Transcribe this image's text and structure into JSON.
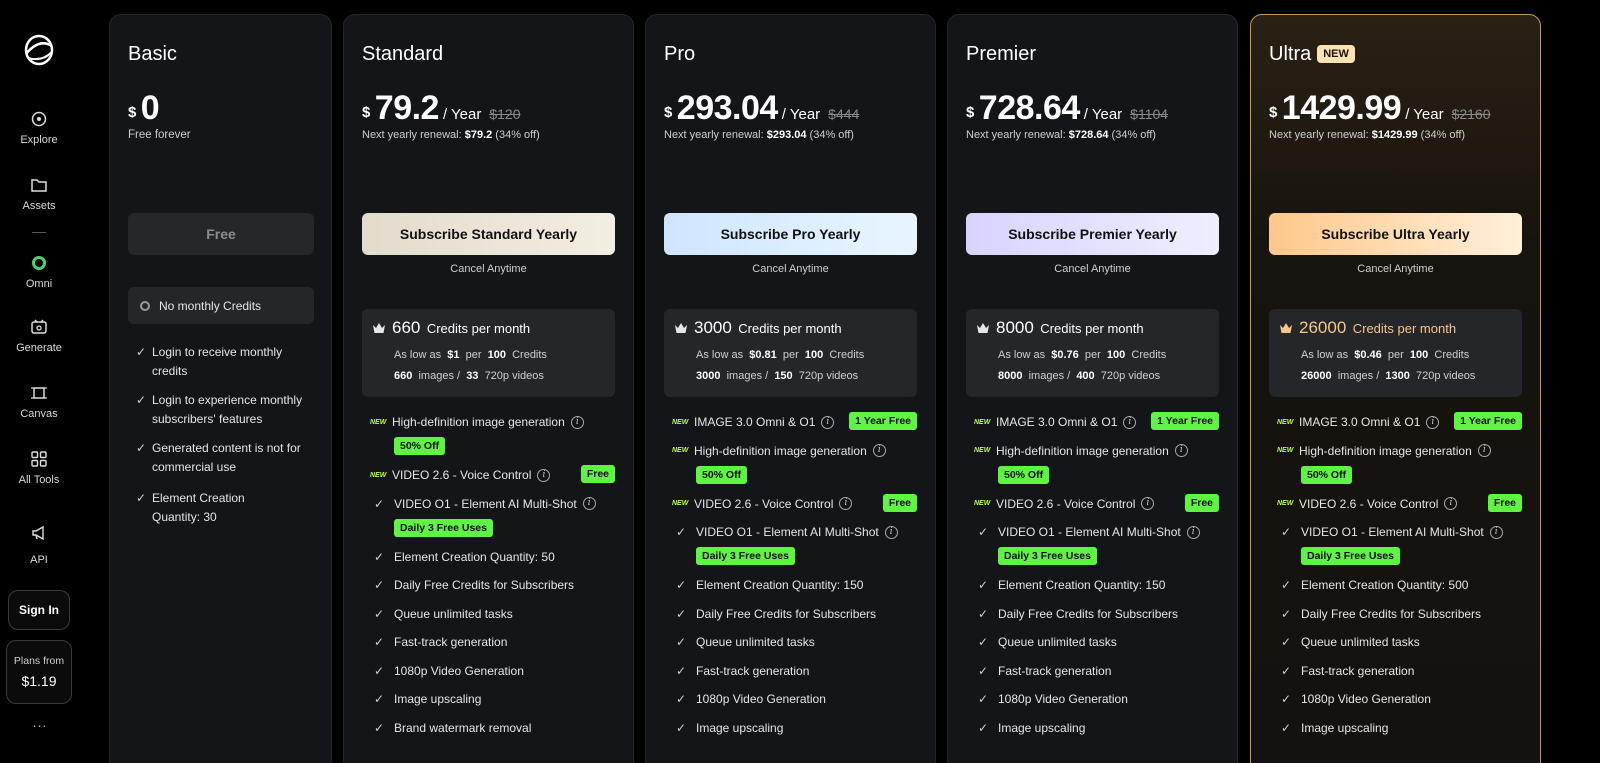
{
  "sidebar": {
    "items": [
      {
        "label": "Explore",
        "icon": "explore-icon"
      },
      {
        "label": "Assets",
        "icon": "folder-icon"
      },
      {
        "label": "Omni",
        "icon": "omni-icon"
      },
      {
        "label": "Generate",
        "icon": "generate-icon"
      },
      {
        "label": "Canvas",
        "icon": "canvas-icon"
      },
      {
        "label": "All Tools",
        "icon": "grid-icon"
      },
      {
        "label": "API",
        "icon": "megaphone-icon"
      }
    ],
    "sign_in": "Sign In",
    "plans_from": "Plans from",
    "plans_price": "$1.19",
    "more": "..."
  },
  "basic": {
    "name": "Basic",
    "currency": "$",
    "price": "0",
    "subtitle": "Free forever",
    "button": "Free",
    "no_credits": "No monthly Credits",
    "features": [
      "Login to receive monthly credits",
      "Login to experience monthly subscribers' features",
      "Generated content is not for commercial use",
      "Element Creation Quantity: 30"
    ]
  },
  "plans": [
    {
      "name": "Standard",
      "currency": "$",
      "price": "79.2",
      "per": "/ Year",
      "original": "$120",
      "renew_prefix": "Next yearly renewal: ",
      "renew_amount": "$79.2",
      "renew_suffix": " (34% off)",
      "button": "Subscribe Standard Yearly",
      "cancel": "Cancel Anytime",
      "credits": "660",
      "credits_label": "Credits per month",
      "as_low_as": "As low as",
      "unit_price": "$1",
      "per_word": "per",
      "per_count": "100",
      "credits_word": "Credits",
      "images": "660",
      "images_label": "images /",
      "videos": "33",
      "videos_label": "720p videos",
      "features": [
        {
          "text": "High-definition image generation",
          "new": true,
          "info": true,
          "tag": "50% Off",
          "tag_below": true
        },
        {
          "text": "VIDEO 2.6 - Voice Control",
          "new": true,
          "info": true,
          "tag": "Free",
          "tag_below": false
        },
        {
          "text": "VIDEO O1 - Element AI Multi-Shot",
          "new": false,
          "info": true,
          "tag": "Daily 3 Free Uses",
          "tag_below": true
        },
        {
          "text": "Element Creation Quantity: 50"
        },
        {
          "text": "Daily Free Credits for Subscribers"
        },
        {
          "text": "Queue unlimited tasks"
        },
        {
          "text": "Fast-track generation"
        },
        {
          "text": "1080p Video Generation"
        },
        {
          "text": "Image upscaling"
        },
        {
          "text": "Brand watermark removal"
        }
      ]
    },
    {
      "name": "Pro",
      "currency": "$",
      "price": "293.04",
      "per": "/ Year",
      "original": "$444",
      "renew_prefix": "Next yearly renewal: ",
      "renew_amount": "$293.04",
      "renew_suffix": " (34% off)",
      "button": "Subscribe Pro Yearly",
      "cancel": "Cancel Anytime",
      "credits": "3000",
      "credits_label": "Credits per month",
      "as_low_as": "As low as",
      "unit_price": "$0.81",
      "per_word": "per",
      "per_count": "100",
      "credits_word": "Credits",
      "images": "3000",
      "images_label": "images /",
      "videos": "150",
      "videos_label": "720p videos",
      "features": [
        {
          "text": "IMAGE 3.0 Omni & O1",
          "new": true,
          "info": true,
          "tag": "1 Year Free",
          "tag_below": false
        },
        {
          "text": "High-definition image generation",
          "new": true,
          "info": true,
          "tag": "50% Off",
          "tag_below": true
        },
        {
          "text": "VIDEO 2.6 - Voice Control",
          "new": true,
          "info": true,
          "tag": "Free",
          "tag_below": false
        },
        {
          "text": "VIDEO O1 - Element AI Multi-Shot",
          "new": false,
          "info": true,
          "tag": "Daily 3 Free Uses",
          "tag_below": true
        },
        {
          "text": "Element Creation Quantity: 150"
        },
        {
          "text": "Daily Free Credits for Subscribers"
        },
        {
          "text": "Queue unlimited tasks"
        },
        {
          "text": "Fast-track generation"
        },
        {
          "text": "1080p Video Generation"
        },
        {
          "text": "Image upscaling"
        }
      ]
    },
    {
      "name": "Premier",
      "currency": "$",
      "price": "728.64",
      "per": "/ Year",
      "original": "$1104",
      "renew_prefix": "Next yearly renewal: ",
      "renew_amount": "$728.64",
      "renew_suffix": " (34% off)",
      "button": "Subscribe Premier Yearly",
      "cancel": "Cancel Anytime",
      "credits": "8000",
      "credits_label": "Credits per month",
      "as_low_as": "As low as",
      "unit_price": "$0.76",
      "per_word": "per",
      "per_count": "100",
      "credits_word": "Credits",
      "images": "8000",
      "images_label": "images /",
      "videos": "400",
      "videos_label": "720p videos",
      "features": [
        {
          "text": "IMAGE 3.0 Omni & O1",
          "new": true,
          "info": true,
          "tag": "1 Year Free",
          "tag_below": false
        },
        {
          "text": "High-definition image generation",
          "new": true,
          "info": true,
          "tag": "50% Off",
          "tag_below": true
        },
        {
          "text": "VIDEO 2.6 - Voice Control",
          "new": true,
          "info": true,
          "tag": "Free",
          "tag_below": false
        },
        {
          "text": "VIDEO O1 - Element AI Multi-Shot",
          "new": false,
          "info": true,
          "tag": "Daily 3 Free Uses",
          "tag_below": true
        },
        {
          "text": "Element Creation Quantity: 150"
        },
        {
          "text": "Daily Free Credits for Subscribers"
        },
        {
          "text": "Queue unlimited tasks"
        },
        {
          "text": "Fast-track generation"
        },
        {
          "text": "1080p Video Generation"
        },
        {
          "text": "Image upscaling"
        }
      ]
    },
    {
      "name": "Ultra",
      "badge": "NEW",
      "currency": "$",
      "price": "1429.99",
      "per": "/ Year",
      "original": "$2160",
      "renew_prefix": "Next yearly renewal: ",
      "renew_amount": "$1429.99",
      "renew_suffix": " (34% off)",
      "button": "Subscribe Ultra Yearly",
      "cancel": "Cancel Anytime",
      "credits": "26000",
      "credits_label": "Credits per month",
      "as_low_as": "As low as",
      "unit_price": "$0.46",
      "per_word": "per",
      "per_count": "100",
      "credits_word": "Credits",
      "images": "26000",
      "images_label": "images /",
      "videos": "1300",
      "videos_label": "720p videos",
      "features": [
        {
          "text": "IMAGE 3.0 Omni & O1",
          "new": true,
          "info": true,
          "tag": "1 Year Free",
          "tag_below": false
        },
        {
          "text": "High-definition image generation",
          "new": true,
          "info": true,
          "tag": "50% Off",
          "tag_below": true
        },
        {
          "text": "VIDEO 2.6 - Voice Control",
          "new": true,
          "info": true,
          "tag": "Free",
          "tag_below": false
        },
        {
          "text": "VIDEO O1 - Element AI Multi-Shot",
          "new": false,
          "info": true,
          "tag": "Daily 3 Free Uses",
          "tag_below": true
        },
        {
          "text": "Element Creation Quantity: 500"
        },
        {
          "text": "Daily Free Credits for Subscribers"
        },
        {
          "text": "Queue unlimited tasks"
        },
        {
          "text": "Fast-track generation"
        },
        {
          "text": "1080p Video Generation"
        },
        {
          "text": "Image upscaling"
        }
      ]
    }
  ],
  "new_label": "NEW",
  "colors": {
    "standard_button": "#ece5d6",
    "pro_button": "#dbeeff",
    "premier_button": "#e4e3ff",
    "ultra_button": "#ffd9a3",
    "green_tag": "#5ef542",
    "ultra_accent": "#f5c68a"
  }
}
